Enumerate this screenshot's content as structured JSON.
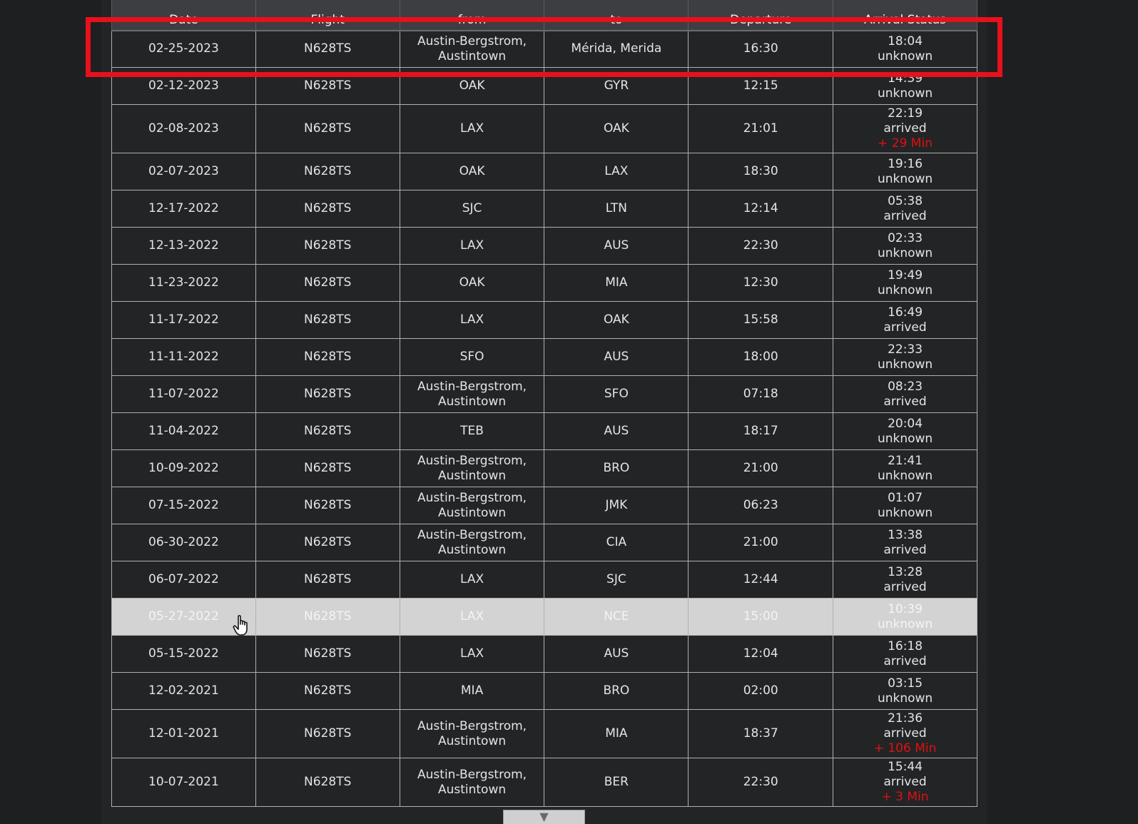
{
  "columns": [
    "Date",
    "Flight",
    "from",
    "to",
    "Departure",
    "Arrival Status"
  ],
  "rows": [
    {
      "date": "02-25-2023",
      "flight": "N628TS",
      "from": "Austin-Bergstrom, Austintown",
      "to": "Mérida, Merida",
      "departure": "16:30",
      "arrival": "18:04",
      "status": "unknown",
      "delay": ""
    },
    {
      "date": "02-12-2023",
      "flight": "N628TS",
      "from": "OAK",
      "to": "GYR",
      "departure": "12:15",
      "arrival": "14:39",
      "status": "unknown",
      "delay": ""
    },
    {
      "date": "02-08-2023",
      "flight": "N628TS",
      "from": "LAX",
      "to": "OAK",
      "departure": "21:01",
      "arrival": "22:19",
      "status": "arrived",
      "delay": "+ 29 Min"
    },
    {
      "date": "02-07-2023",
      "flight": "N628TS",
      "from": "OAK",
      "to": "LAX",
      "departure": "18:30",
      "arrival": "19:16",
      "status": "unknown",
      "delay": ""
    },
    {
      "date": "12-17-2022",
      "flight": "N628TS",
      "from": "SJC",
      "to": "LTN",
      "departure": "12:14",
      "arrival": "05:38",
      "status": "arrived",
      "delay": ""
    },
    {
      "date": "12-13-2022",
      "flight": "N628TS",
      "from": "LAX",
      "to": "AUS",
      "departure": "22:30",
      "arrival": "02:33",
      "status": "unknown",
      "delay": ""
    },
    {
      "date": "11-23-2022",
      "flight": "N628TS",
      "from": "OAK",
      "to": "MIA",
      "departure": "12:30",
      "arrival": "19:49",
      "status": "unknown",
      "delay": ""
    },
    {
      "date": "11-17-2022",
      "flight": "N628TS",
      "from": "LAX",
      "to": "OAK",
      "departure": "15:58",
      "arrival": "16:49",
      "status": "arrived",
      "delay": ""
    },
    {
      "date": "11-11-2022",
      "flight": "N628TS",
      "from": "SFO",
      "to": "AUS",
      "departure": "18:00",
      "arrival": "22:33",
      "status": "unknown",
      "delay": ""
    },
    {
      "date": "11-07-2022",
      "flight": "N628TS",
      "from": "Austin-Bergstrom, Austintown",
      "to": "SFO",
      "departure": "07:18",
      "arrival": "08:23",
      "status": "arrived",
      "delay": ""
    },
    {
      "date": "11-04-2022",
      "flight": "N628TS",
      "from": "TEB",
      "to": "AUS",
      "departure": "18:17",
      "arrival": "20:04",
      "status": "unknown",
      "delay": ""
    },
    {
      "date": "10-09-2022",
      "flight": "N628TS",
      "from": "Austin-Bergstrom, Austintown",
      "to": "BRO",
      "departure": "21:00",
      "arrival": "21:41",
      "status": "unknown",
      "delay": ""
    },
    {
      "date": "07-15-2022",
      "flight": "N628TS",
      "from": "Austin-Bergstrom, Austintown",
      "to": "JMK",
      "departure": "06:23",
      "arrival": "01:07",
      "status": "unknown",
      "delay": ""
    },
    {
      "date": "06-30-2022",
      "flight": "N628TS",
      "from": "Austin-Bergstrom, Austintown",
      "to": "CIA",
      "departure": "21:00",
      "arrival": "13:38",
      "status": "arrived",
      "delay": ""
    },
    {
      "date": "06-07-2022",
      "flight": "N628TS",
      "from": "LAX",
      "to": "SJC",
      "departure": "12:44",
      "arrival": "13:28",
      "status": "arrived",
      "delay": ""
    },
    {
      "date": "05-27-2022",
      "flight": "N628TS",
      "from": "LAX",
      "to": "NCE",
      "departure": "15:00",
      "arrival": "10:39",
      "status": "unknown",
      "delay": ""
    },
    {
      "date": "05-15-2022",
      "flight": "N628TS",
      "from": "LAX",
      "to": "AUS",
      "departure": "12:04",
      "arrival": "16:18",
      "status": "arrived",
      "delay": ""
    },
    {
      "date": "12-02-2021",
      "flight": "N628TS",
      "from": "MIA",
      "to": "BRO",
      "departure": "02:00",
      "arrival": "03:15",
      "status": "unknown",
      "delay": ""
    },
    {
      "date": "12-01-2021",
      "flight": "N628TS",
      "from": "Austin-Bergstrom, Austintown",
      "to": "MIA",
      "departure": "18:37",
      "arrival": "21:36",
      "status": "arrived",
      "delay": "+ 106 Min"
    },
    {
      "date": "10-07-2021",
      "flight": "N628TS",
      "from": "Austin-Bergstrom, Austintown",
      "to": "BER",
      "departure": "22:30",
      "arrival": "15:44",
      "status": "arrived",
      "delay": "+ 3 Min"
    }
  ],
  "highlighted_row_index": 15,
  "scroll_button_glyph": "▼",
  "colors": {
    "delay": "#e01010",
    "highlight_box": "#e8101c",
    "hover_row": "#d3d3d3"
  }
}
